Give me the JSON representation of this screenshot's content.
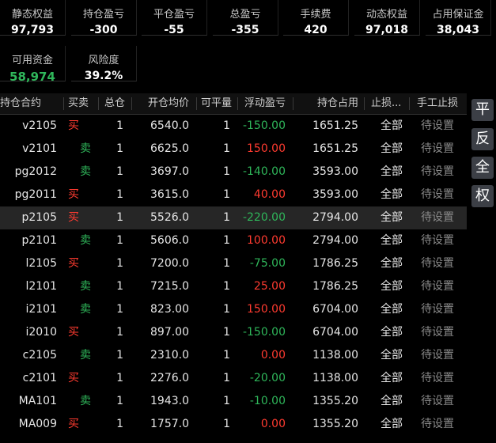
{
  "stats": [
    {
      "label": "静态权益",
      "value": "97,793"
    },
    {
      "label": "持仓盈亏",
      "value": "-300"
    },
    {
      "label": "平仓盈亏",
      "value": "-55"
    },
    {
      "label": "总盈亏",
      "value": "-355"
    },
    {
      "label": "手续费",
      "value": "420"
    },
    {
      "label": "动态权益",
      "value": "97,018"
    },
    {
      "label": "占用保证金",
      "value": "38,043"
    },
    {
      "label": "可用资金",
      "value": "58,974"
    },
    {
      "label": "风险度",
      "value": "39.2%"
    }
  ],
  "table": {
    "headers": {
      "symbol": "持仓合约",
      "direction": "买卖",
      "total": "总仓",
      "avg_price": "开仓均价",
      "closable": "可平量",
      "float_pnl": "浮动盈亏",
      "margin": "持仓占用",
      "stop_loss": "止损...",
      "manual_stop": "手工止损"
    },
    "rows": [
      {
        "symbol": "v2105",
        "direction": "买",
        "side": "buy",
        "total": "1",
        "avg_price": "6540.0",
        "closable": "1",
        "float_pnl": "-150.00",
        "margin": "1651.25",
        "stop_loss": "全部",
        "manual_stop": "待设置"
      },
      {
        "symbol": "v2101",
        "direction": "卖",
        "side": "sell",
        "total": "1",
        "avg_price": "6625.0",
        "closable": "1",
        "float_pnl": "150.00",
        "margin": "1651.25",
        "stop_loss": "全部",
        "manual_stop": "待设置"
      },
      {
        "symbol": "pg2012",
        "direction": "卖",
        "side": "sell",
        "total": "1",
        "avg_price": "3697.0",
        "closable": "1",
        "float_pnl": "-140.00",
        "margin": "3593.00",
        "stop_loss": "全部",
        "manual_stop": "待设置"
      },
      {
        "symbol": "pg2011",
        "direction": "买",
        "side": "buy",
        "total": "1",
        "avg_price": "3615.0",
        "closable": "1",
        "float_pnl": "40.00",
        "margin": "3593.00",
        "stop_loss": "全部",
        "manual_stop": "待设置"
      },
      {
        "symbol": "p2105",
        "direction": "买",
        "side": "buy",
        "total": "1",
        "avg_price": "5526.0",
        "closable": "1",
        "float_pnl": "-220.00",
        "margin": "2794.00",
        "stop_loss": "全部",
        "manual_stop": "待设置"
      },
      {
        "symbol": "p2101",
        "direction": "卖",
        "side": "sell",
        "total": "1",
        "avg_price": "5606.0",
        "closable": "1",
        "float_pnl": "100.00",
        "margin": "2794.00",
        "stop_loss": "全部",
        "manual_stop": "待设置"
      },
      {
        "symbol": "l2105",
        "direction": "买",
        "side": "buy",
        "total": "1",
        "avg_price": "7200.0",
        "closable": "1",
        "float_pnl": "-75.00",
        "margin": "1786.25",
        "stop_loss": "全部",
        "manual_stop": "待设置"
      },
      {
        "symbol": "l2101",
        "direction": "卖",
        "side": "sell",
        "total": "1",
        "avg_price": "7215.0",
        "closable": "1",
        "float_pnl": "25.00",
        "margin": "1786.25",
        "stop_loss": "全部",
        "manual_stop": "待设置"
      },
      {
        "symbol": "i2101",
        "direction": "卖",
        "side": "sell",
        "total": "1",
        "avg_price": "823.00",
        "closable": "1",
        "float_pnl": "150.00",
        "margin": "6704.00",
        "stop_loss": "全部",
        "manual_stop": "待设置"
      },
      {
        "symbol": "i2010",
        "direction": "买",
        "side": "buy",
        "total": "1",
        "avg_price": "897.00",
        "closable": "1",
        "float_pnl": "-150.00",
        "margin": "6704.00",
        "stop_loss": "全部",
        "manual_stop": "待设置"
      },
      {
        "symbol": "c2105",
        "direction": "卖",
        "side": "sell",
        "total": "1",
        "avg_price": "2310.0",
        "closable": "1",
        "float_pnl": "0.00",
        "margin": "1138.00",
        "stop_loss": "全部",
        "manual_stop": "待设置"
      },
      {
        "symbol": "c2101",
        "direction": "买",
        "side": "buy",
        "total": "1",
        "avg_price": "2276.0",
        "closable": "1",
        "float_pnl": "-20.00",
        "margin": "1138.00",
        "stop_loss": "全部",
        "manual_stop": "待设置"
      },
      {
        "symbol": "MA101",
        "direction": "卖",
        "side": "sell",
        "total": "1",
        "avg_price": "1943.0",
        "closable": "1",
        "float_pnl": "-10.00",
        "margin": "1355.20",
        "stop_loss": "全部",
        "manual_stop": "待设置"
      },
      {
        "symbol": "MA009",
        "direction": "买",
        "side": "buy",
        "total": "1",
        "avg_price": "1757.0",
        "closable": "1",
        "float_pnl": "0.00",
        "margin": "1355.20",
        "stop_loss": "全部",
        "manual_stop": "待设置"
      }
    ],
    "selected_row": 4
  },
  "side_buttons": [
    "平",
    "反",
    "全",
    "权"
  ],
  "colors": {
    "background": "#000000",
    "buy": "#ff3b30",
    "sell": "#2fb65a",
    "profit": "#ff3b30",
    "loss": "#2fb65a",
    "available_funds": "#2fb65a",
    "button": "#3c3f46"
  }
}
